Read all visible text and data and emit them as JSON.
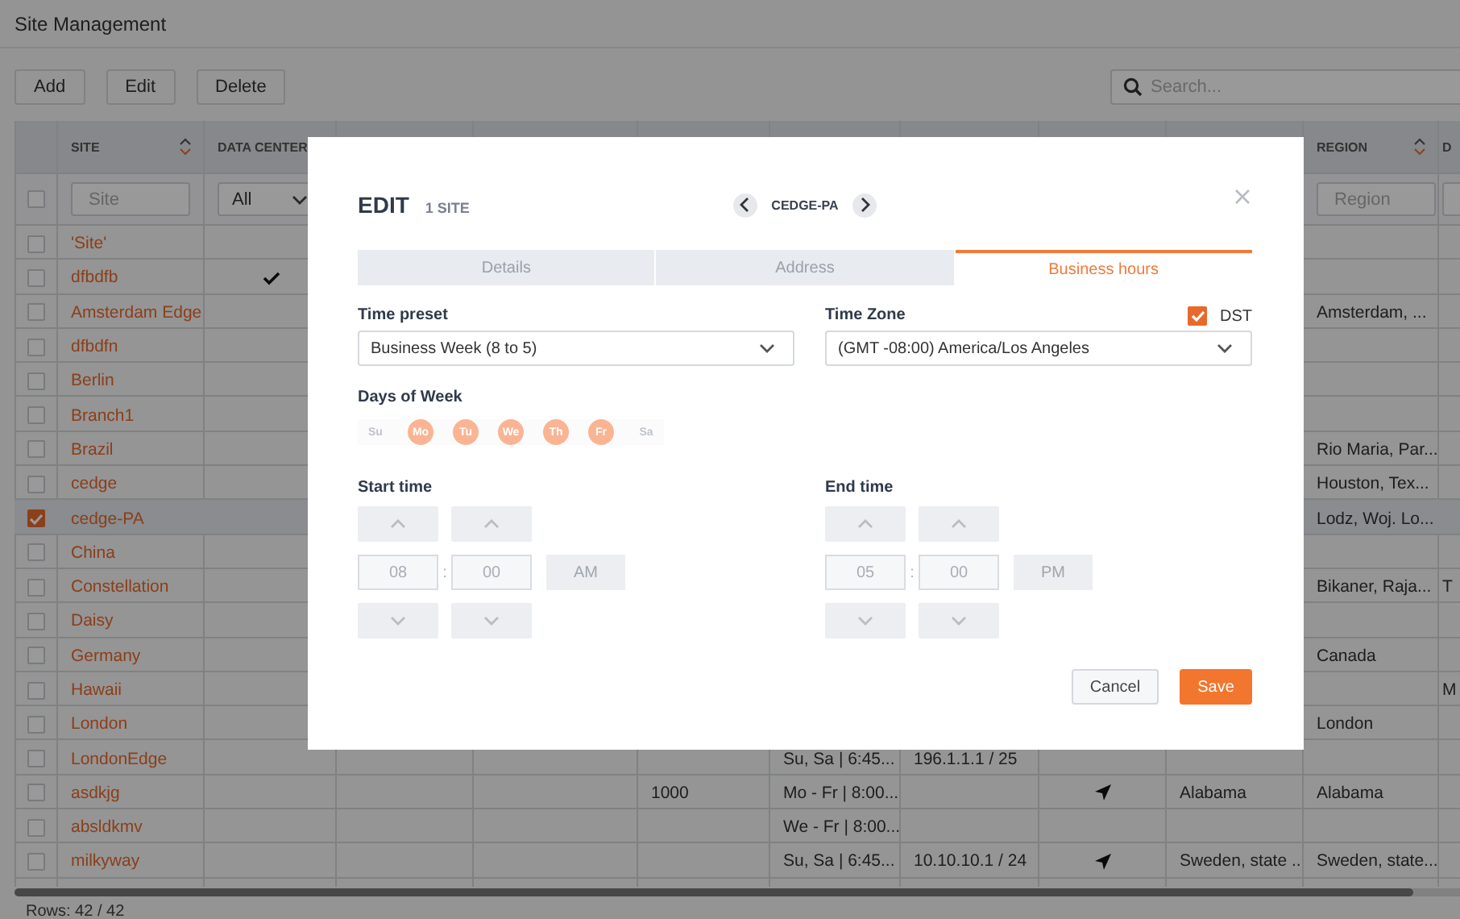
{
  "page": {
    "title": "Site Management"
  },
  "toolbar": {
    "buttons": [
      "Add",
      "Edit",
      "Delete"
    ],
    "search": {
      "placeholder": "Search..."
    }
  },
  "table": {
    "columns": [
      {
        "label": "SITE",
        "sortable": true
      },
      {
        "label": "DATA CENTER",
        "sortable": false
      },
      {
        "label": "REGION",
        "sortable": true
      },
      {
        "label": "D"
      }
    ],
    "filters": {
      "select_all": {
        "checked": false
      },
      "site": {
        "kind": "field",
        "placeholder": "Site"
      },
      "data_center": {
        "kind": "select",
        "value": "All"
      },
      "region": {
        "kind": "field",
        "placeholder": "Region"
      },
      "column_12": {
        "kind": "field"
      }
    },
    "rows": [
      {
        "checked": false,
        "site": "'Site'"
      },
      {
        "checked": false,
        "site": "dfbdfb",
        "data_center": {
          "kind": "check"
        }
      },
      {
        "checked": false,
        "site": "Amsterdam Edge",
        "region": "Amsterdam, ..."
      },
      {
        "checked": false,
        "site": "dfbdfn"
      },
      {
        "checked": false,
        "site": "Berlin"
      },
      {
        "checked": false,
        "site": "Branch1"
      },
      {
        "checked": false,
        "site": "Brazil",
        "region": "Rio Maria, Par..."
      },
      {
        "checked": false,
        "site": "cedge",
        "region": "Houston, Tex..."
      },
      {
        "checked": true,
        "site": "cedge-PA",
        "region": "Lodz, Woj. Lo..."
      },
      {
        "checked": false,
        "site": "China"
      },
      {
        "checked": false,
        "site": "Constellation",
        "region": "Bikaner, Raja...",
        "column_12": "T"
      },
      {
        "checked": false,
        "site": "Daisy"
      },
      {
        "checked": false,
        "site": "Germany",
        "region": "Canada"
      },
      {
        "checked": false,
        "site": "Hawaii",
        "column_12": "M"
      },
      {
        "checked": false,
        "site": "London",
        "region": "London"
      },
      {
        "checked": false,
        "site": "LondonEdge",
        "column_7": "Su, Sa | 6:45...",
        "column_8": "196.1.1.1 / 25"
      },
      {
        "checked": false,
        "site": "asdkjg",
        "column_6": "1000",
        "column_7": "Mo - Fr | 8:00...",
        "column_9": {
          "kind": "arrow"
        },
        "column_10": "Alabama",
        "region": "Alabama"
      },
      {
        "checked": false,
        "site": "absldkmv",
        "column_7": "We - Fr | 8:00..."
      },
      {
        "checked": false,
        "site": "milkyway",
        "column_7": "Su, Sa | 6:45...",
        "column_8": "10.10.10.1 / 24",
        "column_9": {
          "kind": "arrow"
        },
        "column_10": "Sweden, state ..",
        "region": "Sweden, state..."
      }
    ],
    "footer": "Rows: 42 / 42"
  },
  "dialog": {
    "title": "EDIT",
    "subtitle": "1 SITE",
    "current": "CEDGE-PA",
    "tabs": [
      {
        "label": "Details",
        "selected": false
      },
      {
        "label": "Address",
        "selected": false
      },
      {
        "label": "Business hours",
        "selected": true
      }
    ],
    "time_preset": {
      "label": "Time preset",
      "value": "Business Week (8 to 5)"
    },
    "time_zone": {
      "label": "Time Zone",
      "value": "(GMT -08:00) America/Los Angeles"
    },
    "dst": {
      "label": "DST",
      "checked": true
    },
    "days": {
      "label": "Days of Week",
      "items": [
        {
          "label": "Su",
          "selected": false
        },
        {
          "label": "Mo",
          "selected": true
        },
        {
          "label": "Tu",
          "selected": true
        },
        {
          "label": "We",
          "selected": true
        },
        {
          "label": "Th",
          "selected": true
        },
        {
          "label": "Fr",
          "selected": true
        },
        {
          "label": "Sa",
          "selected": false
        }
      ]
    },
    "start": {
      "label": "Start time",
      "hour": "08",
      "separator": ":",
      "minute": "00",
      "period": "AM"
    },
    "end": {
      "label": "End time",
      "hour": "05",
      "separator": ":",
      "minute": "00",
      "period": "PM"
    },
    "buttons": [
      {
        "label": "Cancel",
        "kind": "secondary"
      },
      {
        "label": "Save",
        "kind": "primary"
      }
    ]
  }
}
